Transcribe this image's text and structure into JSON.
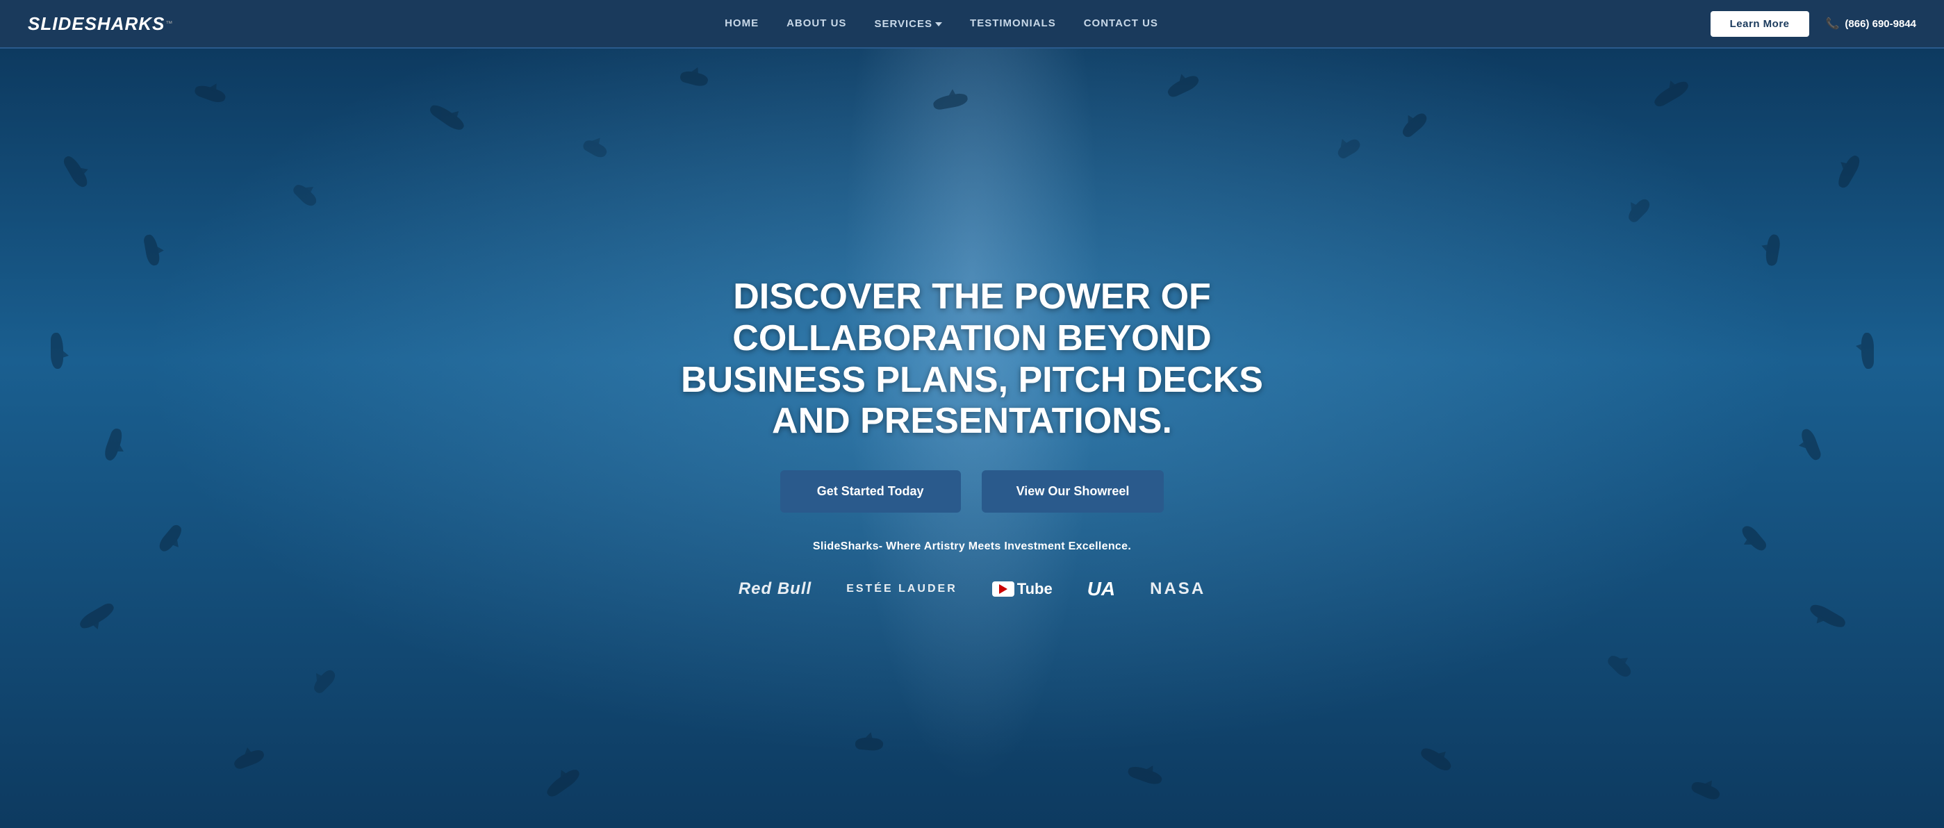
{
  "nav": {
    "logo": {
      "slide": "SLIDE",
      "sharks": "SHARKS",
      "tm": "™"
    },
    "links": [
      {
        "id": "home",
        "label": "HOME"
      },
      {
        "id": "about",
        "label": "ABOUT US"
      },
      {
        "id": "services",
        "label": "SERVICES",
        "hasDropdown": true
      },
      {
        "id": "testimonials",
        "label": "TESTIMONIALS"
      },
      {
        "id": "contact",
        "label": "CONTACT US"
      }
    ],
    "cta": {
      "learn_more": "Learn More"
    },
    "phone": {
      "icon": "📞",
      "number": "(866) 690-9844"
    }
  },
  "hero": {
    "title": "DISCOVER THE POWER OF COLLABORATION BEYOND BUSINESS PLANS, PITCH DECKS AND PRESENTATIONS.",
    "buttons": {
      "get_started": "Get Started Today",
      "showreel": "View Our Showreel"
    },
    "tagline": "SlideSharks- Where Artistry Meets Investment Excellence.",
    "brands": [
      {
        "id": "redbull",
        "label": "Red Bull"
      },
      {
        "id": "estee",
        "label": "ESTÉE LAUDER"
      },
      {
        "id": "youtube",
        "label": "YouTube"
      },
      {
        "id": "underarmour",
        "label": "UA"
      },
      {
        "id": "nasa",
        "label": "NASA"
      }
    ]
  },
  "colors": {
    "nav_bg": "#1a3a5c",
    "hero_bg": "#1a5080",
    "btn_primary": "#2a5a8c",
    "white": "#ffffff",
    "accent": "#c8d8e8"
  }
}
